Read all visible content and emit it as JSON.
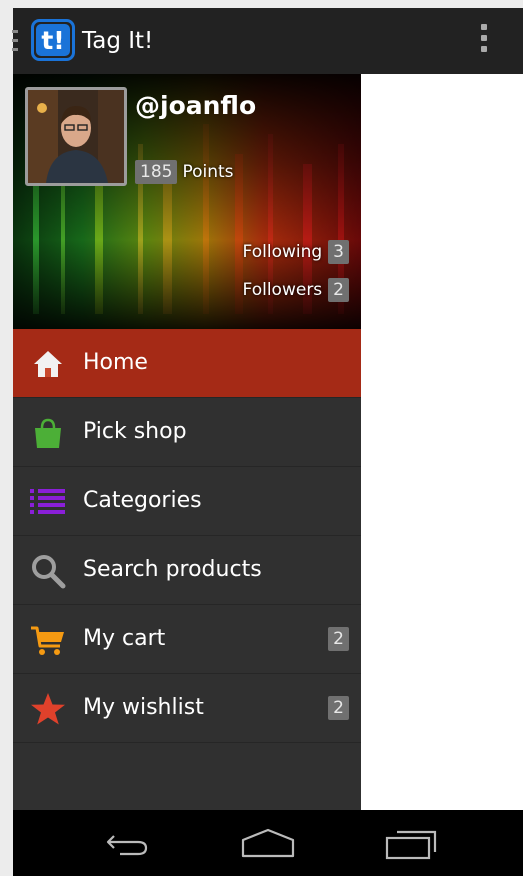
{
  "app": {
    "title": "Tag It!",
    "logo_text": "t!"
  },
  "profile": {
    "username": "@joanflo",
    "points": "185",
    "points_label": "Points",
    "following_label": "Following",
    "following_count": "3",
    "followers_label": "Followers",
    "followers_count": "2"
  },
  "menu": {
    "items": [
      {
        "label": "Home",
        "icon": "home-icon",
        "active": true
      },
      {
        "label": "Pick shop",
        "icon": "shopping-bag-icon"
      },
      {
        "label": "Categories",
        "icon": "list-icon"
      },
      {
        "label": "Search products",
        "icon": "search-icon"
      },
      {
        "label": "My cart",
        "icon": "cart-icon",
        "count": "2"
      },
      {
        "label": "My wishlist",
        "icon": "star-icon",
        "count": "2"
      }
    ]
  },
  "colors": {
    "active": "#a52a16",
    "bag": "#4caf37",
    "list": "#8a1fd8",
    "cart": "#f59a12",
    "star": "#e0412b",
    "logo": "#1a73d8"
  },
  "navbar": {
    "back": "back-icon",
    "home": "home-nav-icon",
    "recents": "recents-icon"
  }
}
